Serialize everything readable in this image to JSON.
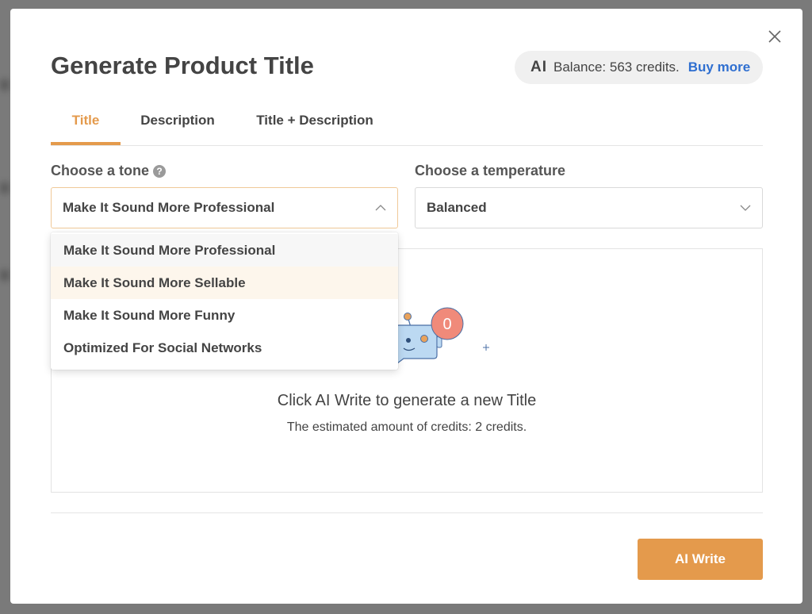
{
  "modal": {
    "title": "Generate Product Title",
    "close_icon": "close-icon",
    "balance": {
      "ai_label": "AI",
      "text": "Balance: 563 credits.",
      "buy_more": "Buy more"
    }
  },
  "tabs": [
    {
      "label": "Title",
      "active": true
    },
    {
      "label": "Description",
      "active": false
    },
    {
      "label": "Title + Description",
      "active": false
    }
  ],
  "tone": {
    "label": "Choose a tone",
    "help_icon": "?",
    "value": "Make It Sound More Professional",
    "options": [
      "Make It Sound More Professional",
      "Make It Sound More Sellable",
      "Make It Sound More Funny",
      "Optimized For Social Networks"
    ]
  },
  "temperature": {
    "label": "Choose a temperature",
    "value": "Balanced"
  },
  "preview": {
    "badge_count": "0",
    "empty_title": "Click AI Write to generate a new Title",
    "empty_subtitle": "The estimated amount of credits: 2 credits."
  },
  "footer": {
    "ai_write_label": "AI Write"
  },
  "colors": {
    "accent": "#e49a4c",
    "link": "#2f6fd0",
    "badge": "#f08a7a",
    "robot": "#bcd9f2"
  }
}
